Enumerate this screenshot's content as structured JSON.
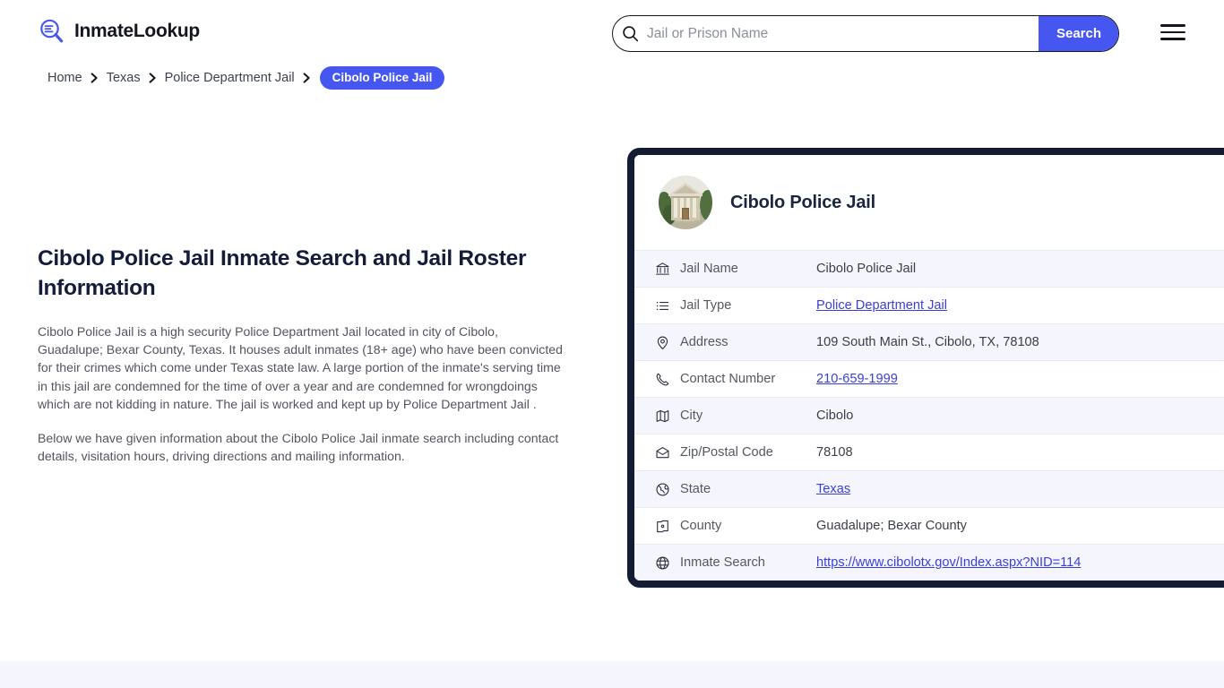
{
  "header": {
    "brand_name": "InmateLookup",
    "brand_icon": "search-list-logo-icon",
    "search": {
      "placeholder": "Jail or Prison Name",
      "value": "",
      "button_label": "Search",
      "icon": "search-icon"
    },
    "menu_icon": "hamburger-menu-icon"
  },
  "breadcrumb": {
    "items": [
      {
        "label": "Home"
      },
      {
        "label": "Texas"
      },
      {
        "label": "Police Department Jail"
      }
    ],
    "current": "Cibolo Police Jail",
    "separator_icon": "chevron-right-icon"
  },
  "article": {
    "heading": "Cibolo Police Jail Inmate Search and Jail Roster Information",
    "paragraph1": "Cibolo Police Jail is a high security Police Department Jail located in city of Cibolo, Guadalupe; Bexar County, Texas. It houses adult inmates (18+ age) who have been convicted for their crimes which come under Texas state law. A large portion of the inmate's serving time in this jail are condemned for the time of over a year and are condemned for wrongdoings which are not kidding in nature. The jail is worked and kept up by Police Department Jail .",
    "paragraph2": "Below we have given information about the Cibolo Police Jail inmate search including contact details, visitation hours, driving directions and mailing information."
  },
  "info_card": {
    "avatar_icon": "courthouse-building-photo",
    "title": "Cibolo Police Jail",
    "rows": [
      {
        "icon": "bank-building-icon",
        "label": "Jail Name",
        "value": "Cibolo Police Jail",
        "is_link": false
      },
      {
        "icon": "list-icon",
        "label": "Jail Type",
        "value": "Police Department Jail",
        "is_link": true
      },
      {
        "icon": "map-pin-icon",
        "label": "Address",
        "value": "109 South Main St., Cibolo, TX, 78108",
        "is_link": false
      },
      {
        "icon": "phone-icon",
        "label": "Contact Number",
        "value": "210-659-1999",
        "is_link": true
      },
      {
        "icon": "map-icon",
        "label": "City",
        "value": "Cibolo",
        "is_link": false
      },
      {
        "icon": "envelope-open-icon",
        "label": "Zip/Postal Code",
        "value": "78108",
        "is_link": false
      },
      {
        "icon": "globe-icon",
        "label": "State",
        "value": "Texas",
        "is_link": true
      },
      {
        "icon": "county-outline-icon",
        "label": "County",
        "value": "Guadalupe; Bexar County",
        "is_link": false
      },
      {
        "icon": "internet-globe-icon",
        "label": "Inmate Search",
        "value": "https://www.cibolotx.gov/Index.aspx?NID=114",
        "is_link": true
      }
    ]
  },
  "colors": {
    "accent_blue": "#4557f0",
    "link_blue": "#3b3fd8",
    "card_border_navy": "#141c33",
    "heading_navy": "#151c3a",
    "row_alt_bg": "#f4f5fd",
    "footer_band_bg": "#f5f6fd"
  }
}
